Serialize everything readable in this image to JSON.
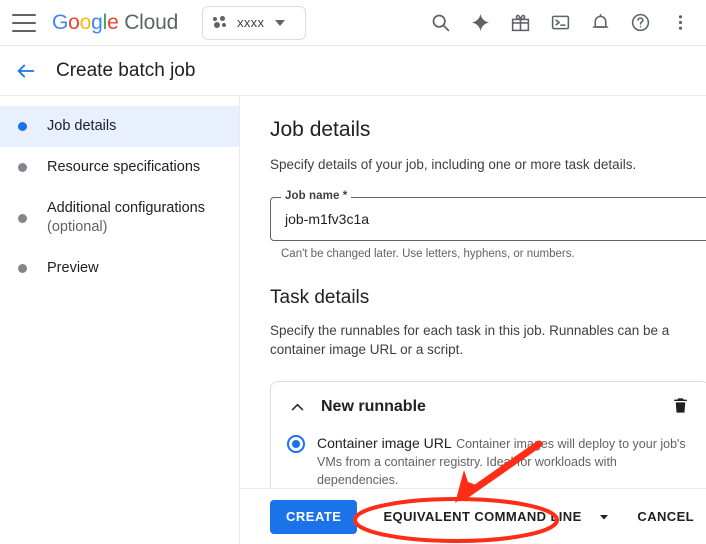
{
  "topbar": {
    "menu_icon": "hamburger-menu-icon",
    "logo": {
      "word1": "Google",
      "word2": "Cloud"
    },
    "project": {
      "name": "xxxx",
      "icon": "project-dots-icon"
    },
    "icons": [
      {
        "name": "search-icon",
        "label": "Search"
      },
      {
        "name": "gemini-sparkle-icon",
        "label": "Gemini"
      },
      {
        "name": "gift-icon",
        "label": "Offers"
      },
      {
        "name": "cloud-shell-terminal-icon",
        "label": "Activate Cloud Shell"
      },
      {
        "name": "notifications-bell-icon",
        "label": "Notifications"
      },
      {
        "name": "help-circle-icon",
        "label": "Help"
      },
      {
        "name": "more-kebab-icon",
        "label": "More options"
      }
    ]
  },
  "page": {
    "back_icon": "back-arrow-icon",
    "title": "Create batch job"
  },
  "sidebar": {
    "items": [
      {
        "label": "Job details",
        "sublabel": "",
        "active": true
      },
      {
        "label": "Resource specifications",
        "sublabel": "",
        "active": false
      },
      {
        "label": "Additional configurations",
        "sublabel": "(optional)",
        "active": false
      },
      {
        "label": "Preview",
        "sublabel": "",
        "active": false
      }
    ]
  },
  "main": {
    "job_details": {
      "heading": "Job details",
      "description": "Specify details of your job, including one or more task details.",
      "job_name_label": "Job name *",
      "job_name_value": "job-m1fv3c1a",
      "job_name_hint": "Can't be changed later. Use letters, hyphens, or numbers."
    },
    "task_details": {
      "heading": "Task details",
      "description": "Specify the runnables for each task in this job. Runnables can be a container image URL or a script.",
      "runnable_card": {
        "title": "New runnable",
        "collapse_icon": "chevron-up-icon",
        "delete_icon": "trash-icon",
        "options": [
          {
            "label": "Container image URL",
            "description": "Container images will deploy to your job's VMs from a container registry. Ideal for workloads with dependencies.",
            "selected": true
          }
        ]
      }
    }
  },
  "footer": {
    "create_label": "CREATE",
    "equivalent_command_line_label": "EQUIVALENT COMMAND LINE",
    "split_caret_icon": "chevron-down-icon",
    "cancel_label": "CANCEL"
  },
  "annotations": {
    "highlight_color": "#ff2d16",
    "highlight_target": "equivalent-command-line-button",
    "arrow": "red-pointer-arrow"
  },
  "colors": {
    "accent": "#1a73e8",
    "selected_nav_bg": "#e8f0fe",
    "text_primary": "#202124",
    "text_secondary": "#5f6368",
    "border": "#dadce0"
  }
}
